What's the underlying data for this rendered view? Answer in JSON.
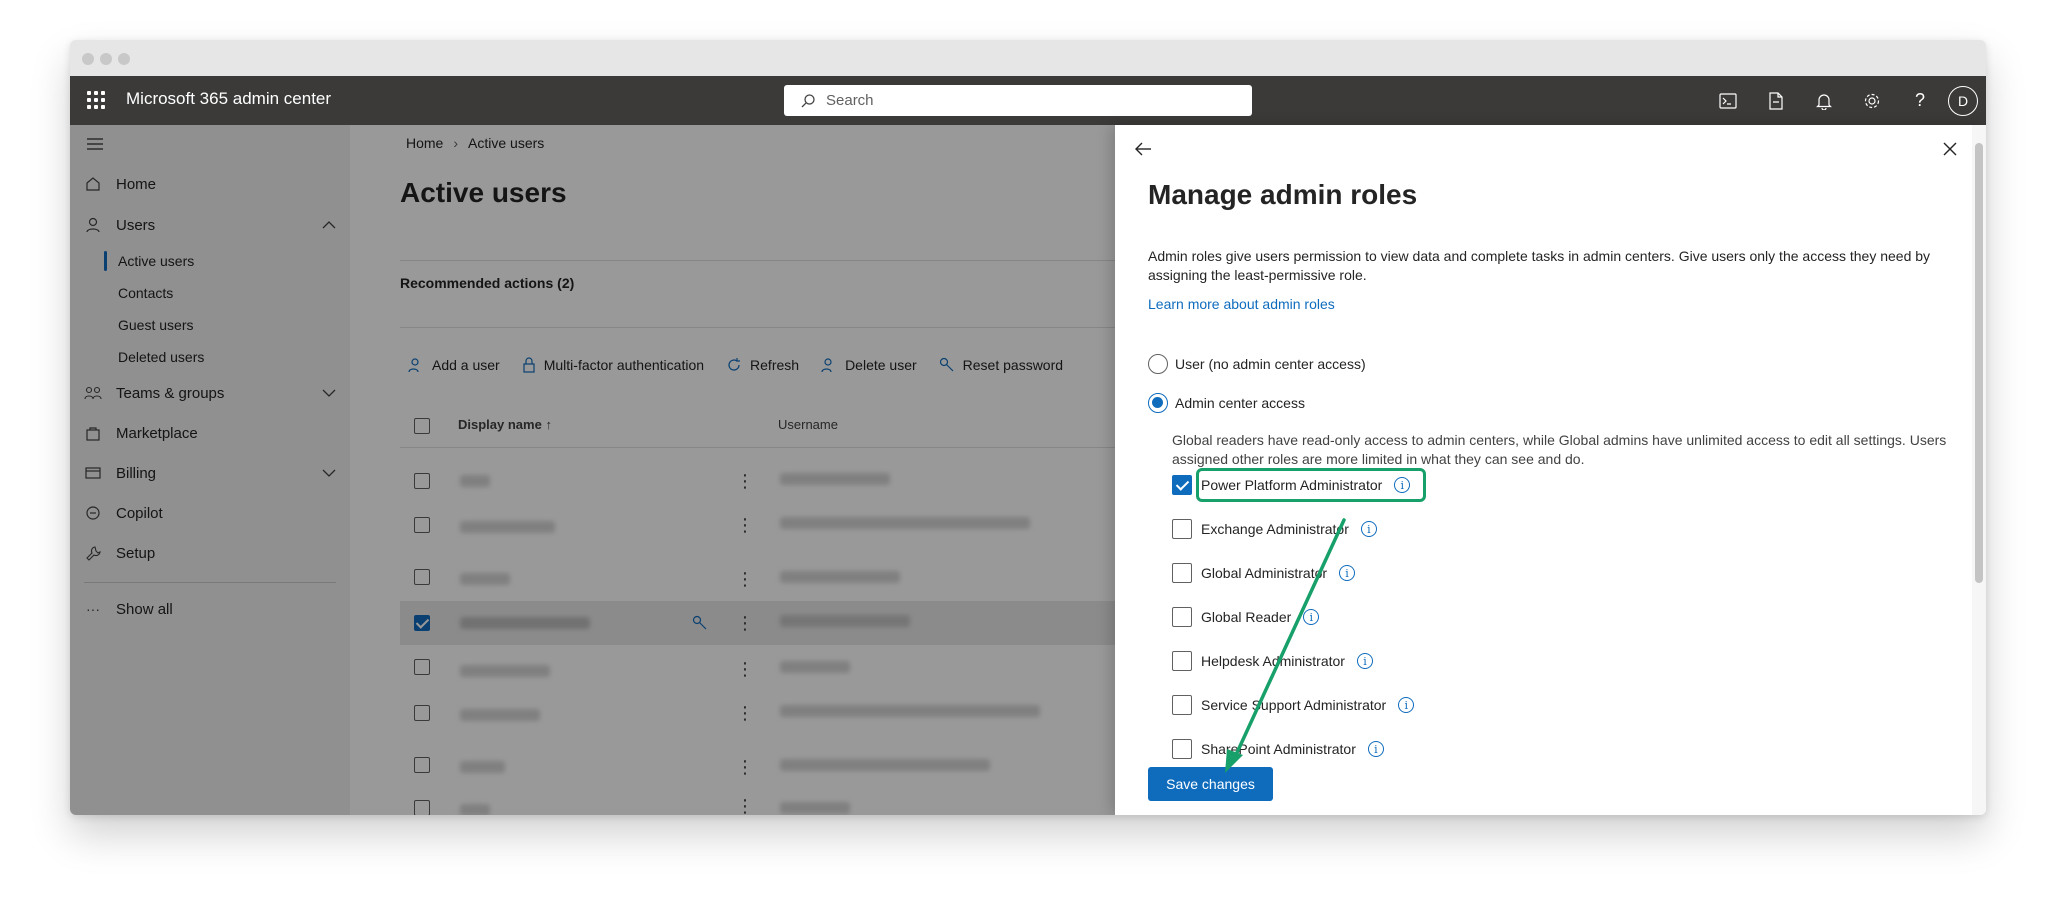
{
  "app": {
    "title": "Microsoft 365 admin center",
    "avatar_initial": "D"
  },
  "search": {
    "placeholder": "Search"
  },
  "topbar_icons": [
    "terminal-icon",
    "document-icon",
    "bell-icon",
    "settings-gear-icon",
    "help-icon"
  ],
  "sidebar": {
    "items": [
      {
        "label": "Home",
        "icon": "home-icon"
      },
      {
        "label": "Users",
        "icon": "person-icon"
      },
      {
        "label": "Teams & groups",
        "icon": "teams-icon"
      },
      {
        "label": "Marketplace",
        "icon": "bag-icon"
      },
      {
        "label": "Billing",
        "icon": "card-icon"
      },
      {
        "label": "Copilot",
        "icon": "copilot-icon"
      },
      {
        "label": "Setup",
        "icon": "wrench-icon"
      }
    ],
    "users_sub": [
      "Active users",
      "Contacts",
      "Guest users",
      "Deleted users"
    ],
    "show_all": "Show all"
  },
  "main": {
    "breadcrumb": [
      "Home",
      "Active users"
    ],
    "title": "Active users",
    "recommended": "Recommended actions (2)",
    "toolbar": [
      "Add a user",
      "Multi-factor authentication",
      "Refresh",
      "Delete user",
      "Reset password"
    ],
    "columns": {
      "display_name": "Display name",
      "sort_indicator": "↑",
      "username": "Username"
    }
  },
  "panel": {
    "title": "Manage admin roles",
    "description": "Admin roles give users permission to view data and complete tasks in admin centers. Give users only the access they need by assigning the least-permissive role.",
    "link": "Learn more about admin roles",
    "radio_user": "User (no admin center access)",
    "radio_admin": "Admin center access",
    "access_description": "Global readers have read-only access to admin centers, while Global admins have unlimited access to edit all settings. Users assigned other roles are more limited in what they can see and do.",
    "roles": [
      {
        "label": "Power Platform Administrator",
        "checked": true
      },
      {
        "label": "Exchange Administrator",
        "checked": false
      },
      {
        "label": "Global Administrator",
        "checked": false
      },
      {
        "label": "Global Reader",
        "checked": false
      },
      {
        "label": "Helpdesk Administrator",
        "checked": false
      },
      {
        "label": "Service Support Administrator",
        "checked": false
      },
      {
        "label": "SharePoint Administrator",
        "checked": false
      }
    ],
    "save_label": "Save changes"
  },
  "colors": {
    "accent": "#0f6cbd",
    "topbar": "#3b3a39",
    "annotation": "#18a06a"
  }
}
